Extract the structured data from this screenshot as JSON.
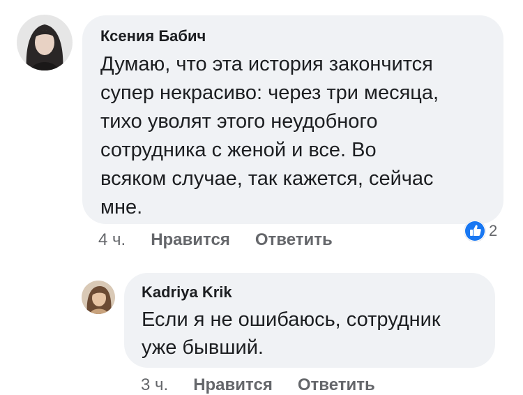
{
  "comments": [
    {
      "author": "Ксения Бабич",
      "text_lines": [
        "Думаю, что эта история закончится",
        "супер некрасиво: через три месяца,",
        "тихо уволят этого неудобного",
        "сотрудника с женой и все. Во",
        "всяком случае, так кажется, сейчас",
        "мне."
      ],
      "time": "4 ч.",
      "like_label": "Нравится",
      "reply_label": "Ответить",
      "reaction_count": "2"
    }
  ],
  "replies": [
    {
      "author": "Kadriya Krik",
      "text_lines": [
        "Если я не ошибаюсь, сотрудник",
        "уже бывший."
      ],
      "time": "3 ч.",
      "like_label": "Нравится",
      "reply_label": "Ответить"
    }
  ],
  "colors": {
    "bubble": "#f0f2f5",
    "meta_text": "#65676b",
    "like_blue": "#1877f2"
  },
  "icons": {
    "reaction": "like-thumbs-up-icon"
  }
}
